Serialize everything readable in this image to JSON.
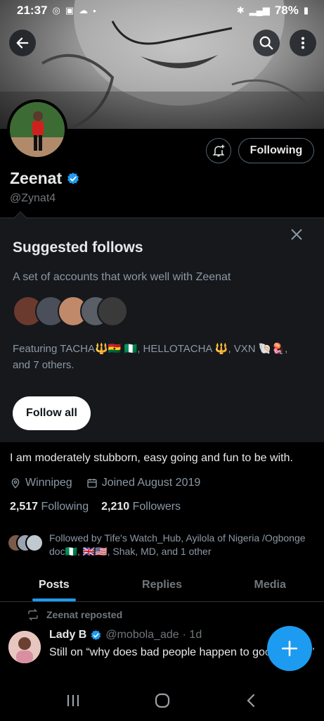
{
  "status_bar": {
    "time": "21:37",
    "battery": "78%"
  },
  "profile": {
    "name": "Zeenat",
    "handle": "@Zynat4",
    "following_button": "Following",
    "bio": "I am moderately stubborn, easy going and fun to be with.",
    "location": "Winnipeg",
    "joined": "Joined August 2019",
    "following_count": "2,517",
    "following_label": "Following",
    "followers_count": "2,210",
    "followers_label": "Followers",
    "followed_by": "Followed by Tife's Watch_Hub, Ayilola of Nigeria /Ogbonge doc🇳🇬, 🇬🇧🇺🇸, Shak, MD, and 1 other"
  },
  "suggested": {
    "title": "Suggested follows",
    "subtitle": "A set of accounts that work well with Zeenat",
    "featuring": "Featuring TACHA🔱🇬🇭 🇳🇬, HELLOTACHA 🔱, VXN 🐚🪼, and 7 others.",
    "follow_all": "Follow all",
    "avatar_colors": [
      "#6b3a2e",
      "#4a4f5a",
      "#c08a6a",
      "#5a5e66",
      "#3a3a3a"
    ]
  },
  "tabs": [
    {
      "label": "Posts",
      "active": true
    },
    {
      "label": "Replies",
      "active": false
    },
    {
      "label": "Media",
      "active": false
    }
  ],
  "post": {
    "repost_label": "Zeenat reposted",
    "author": "Lady B",
    "handle": "@mobola_ade",
    "time": "· 1d",
    "text": "Still on “why does bad people happen to good things”"
  },
  "colors": {
    "accent": "#1d9bf0",
    "background": "#000000",
    "card": "#16181c",
    "muted": "#71767b"
  },
  "icons": [
    "back-arrow-icon",
    "search-icon",
    "more-vertical-icon",
    "bell-plus-icon",
    "verified-badge-icon",
    "close-icon",
    "location-icon",
    "calendar-icon",
    "repost-icon",
    "plus-icon",
    "recents-icon",
    "home-icon",
    "back-nav-icon"
  ]
}
